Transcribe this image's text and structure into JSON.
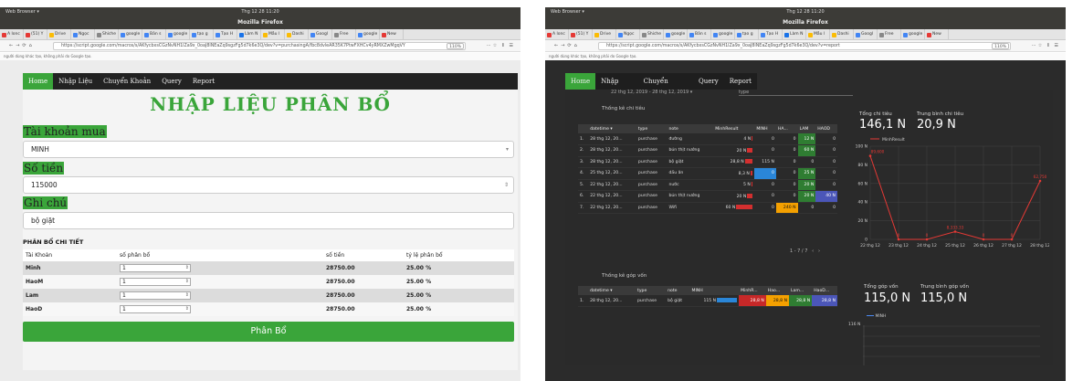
{
  "left_window": {
    "top_menu": "Web Browser ▾",
    "clock": "Thg 12 28  11:20",
    "window_title": "Mozilla Firefox",
    "tabs": [
      "A lonc",
      "(51) Y",
      "Drive",
      "Ngọc",
      "Shiche",
      "google",
      "Bản s",
      "google",
      "tạo g",
      "Tạo H",
      "Làm N",
      "Mẫu l",
      "Dashi",
      "Googl",
      "Free",
      "google",
      "New"
    ],
    "url": "https://script.google.com/macros/s/AKfycbxsCGzNvNH1lZa9x_0oaJ8lNEaZq9sgzFg5d7k6e3Q/dev?v=purchasingA/fbc8dvleAR35K7PtwFXHCv4yRMXZwMgqVY",
    "zoom": "110%",
    "warning": "người dùng khác tạo, không phải do Google tạo.",
    "nav": [
      "Home",
      "Nhập Liệu",
      "Chuyển Khoản",
      "Query",
      "Report"
    ],
    "page_title": "NHẬP LIỆU PHÂN BỔ",
    "labels": {
      "account": "Tài khoản mua",
      "amount": "Số tiền",
      "note": "Ghi chú"
    },
    "values": {
      "account": "MINH",
      "amount": "115000",
      "note": "bộ giặt"
    },
    "section_title": "PHÂN BỔ CHI TIẾT",
    "table_headers": [
      "Tài Khoản",
      "số phân bổ",
      "số tiền",
      "tỷ lệ phân bổ"
    ],
    "table_rows": [
      {
        "account": "Minh",
        "alloc": "1",
        "amount": "28750.00",
        "ratio": "25.00 %"
      },
      {
        "account": "HaoM",
        "alloc": "1",
        "amount": "28750.00",
        "ratio": "25.00 %"
      },
      {
        "account": "Lam",
        "alloc": "1",
        "amount": "28750.00",
        "ratio": "25.00 %"
      },
      {
        "account": "HaoD",
        "alloc": "1",
        "amount": "28750.00",
        "ratio": "25.00 %"
      }
    ],
    "submit": "Phân Bổ"
  },
  "right_window": {
    "top_menu": "Web Browser ▾",
    "clock": "Thg 12 28  11:20",
    "window_title": "Mozilla Firefox",
    "url": "https://script.google.com/macros/s/AKfycbxsCGzNvNH1lZa9x_0oaJ8lNEaZq9sgzFg5d7k6e3Q/dev?v=report",
    "zoom": "110%",
    "warning": "người dùng khác tạo, không phải do Google tạo.",
    "nav": [
      "Home",
      "Nhập Liệu",
      "Chuyển Khoản",
      "Query",
      "Report"
    ],
    "date_range": "22 thg 12, 2019 - 28 thg 12, 2019 ▾",
    "type_select": "type",
    "spend_title": "Thống kê chi tiêu",
    "spend_headers": [
      "",
      "datetime ▾",
      "type",
      "note",
      "MinhResult",
      "MINH",
      "HA...",
      "LAM",
      "HAOD"
    ],
    "spend_rows": [
      [
        "1.",
        "28 thg 12, 20...",
        "purchase",
        "đường",
        "4 N",
        "0",
        "0",
        "12 N",
        "0"
      ],
      [
        "2.",
        "28 thg 12, 20...",
        "purchase",
        "bún thịt nướng",
        "20 N",
        "0",
        "0",
        "60 N",
        "0"
      ],
      [
        "3.",
        "28 thg 12, 20...",
        "purchase",
        "bộ giặt",
        "28,8 N",
        "115 N",
        "0",
        "0",
        "0"
      ],
      [
        "4.",
        "25 thg 12, 20...",
        "purchase",
        "dầu ăn",
        "8,3 N",
        "0",
        "0",
        "25 N",
        "0"
      ],
      [
        "5.",
        "22 thg 12, 20...",
        "purchase",
        "nước",
        "5 N",
        "0",
        "0",
        "20 N",
        "0"
      ],
      [
        "6.",
        "22 thg 12, 20...",
        "purchase",
        "bún thịt nướng",
        "20 N",
        "0",
        "0",
        "20 N",
        "40 N"
      ],
      [
        "7.",
        "22 thg 12, 20...",
        "purchase",
        "Wifi",
        "60 N",
        "0",
        "240 N",
        "0",
        "0"
      ]
    ],
    "pager": "1 - 7 / 7",
    "kpi_total_label": "Tổng chi tiêu",
    "kpi_total": "146,1 N",
    "kpi_avg_label": "Trung bình chi tiêu",
    "kpi_avg": "20,9 N",
    "contrib_title": "Thống kê góp vốn",
    "contrib_headers": [
      "",
      "datetime ▾",
      "type",
      "note",
      "MINH",
      "MinhR...",
      "Hao...",
      "Lam...",
      "HaoD..."
    ],
    "contrib_rows": [
      [
        "1.",
        "28 thg 12, 20...",
        "purchase",
        "bộ giặt",
        "115 N",
        "28,8 N",
        "28,8 N",
        "28,8 N",
        "28,8 N"
      ]
    ],
    "kpi_contrib_label": "Tổng góp vốn",
    "kpi_contrib": "115,0 N",
    "kpi_contrib_avg_label": "Trung bình góp vốn",
    "kpi_contrib_avg": "115,0 N",
    "chart2_legend": "MINH",
    "chart2_top_tick": "116 N"
  },
  "chart_data": {
    "type": "line",
    "series": [
      {
        "name": "MinhResult",
        "values": [
          89.6,
          0,
          0,
          8.33333,
          0,
          0,
          62.75
        ]
      }
    ],
    "categories": [
      "22 thg 12",
      "23 thg 12",
      "24 thg 12",
      "25 thg 12",
      "26 thg 12",
      "27 thg 12",
      "28 thg 12"
    ],
    "point_labels": [
      "89,600",
      "0",
      "0",
      "8,333.33",
      "0",
      "0",
      "62,750"
    ],
    "y_ticks": [
      "0",
      "20 N",
      "40 N",
      "60 N",
      "80 N",
      "100 N"
    ],
    "ylim": [
      0,
      100
    ],
    "legend": "top-left",
    "colors": {
      "line": "#e53935",
      "grid": "#444444"
    }
  }
}
